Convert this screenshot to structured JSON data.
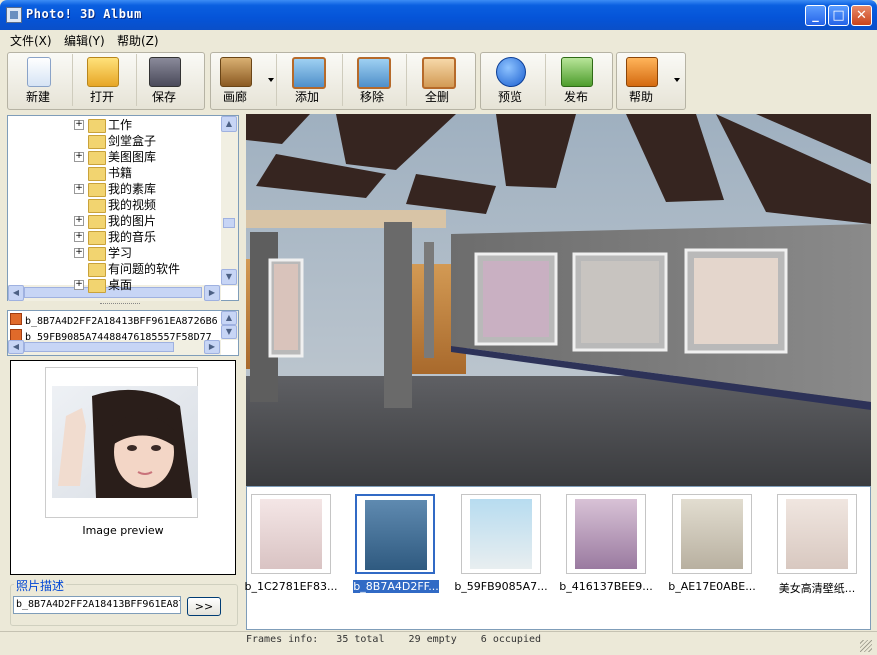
{
  "window": {
    "title": "Photo! 3D Album",
    "controls": {
      "minimize": "_",
      "maximize": "□",
      "close": "✕"
    }
  },
  "menu": [
    "文件(X)",
    "编辑(Y)",
    "帮助(Z)"
  ],
  "toolbar": {
    "new": "新建",
    "open": "打开",
    "save": "保存",
    "gallery": "画廊",
    "add": "添加",
    "remove": "移除",
    "clear_all": "全删",
    "preview": "预览",
    "publish": "发布",
    "help": "帮助"
  },
  "tree": {
    "items": [
      {
        "label": "工作",
        "expandable": true
      },
      {
        "label": "剑堂盒子",
        "expandable": false
      },
      {
        "label": "美图图库",
        "expandable": true
      },
      {
        "label": "书籍",
        "expandable": false
      },
      {
        "label": "我的素库",
        "expandable": true
      },
      {
        "label": "我的视频",
        "expandable": false
      },
      {
        "label": "我的图片",
        "expandable": true
      },
      {
        "label": "我的音乐",
        "expandable": true
      },
      {
        "label": "学习",
        "expandable": true
      },
      {
        "label": "有问题的软件",
        "expandable": false
      },
      {
        "label": "桌面",
        "expandable": true
      }
    ]
  },
  "files": [
    "b_8B7A4D2FF2A18413BFF961EA8726B6",
    "b_59FB9085A74488476185557F58D77"
  ],
  "preview": {
    "caption": "Image preview"
  },
  "description": {
    "legend": "照片描述",
    "value": "b_8B7A4D2FF2A18413BFF961EA87",
    "next_label": ">>"
  },
  "thumbnails": [
    {
      "label": "b_1C2781EF83...",
      "selected": false
    },
    {
      "label": "b_8B7A4D2FF...",
      "selected": true
    },
    {
      "label": "b_59FB9085A7...",
      "selected": false
    },
    {
      "label": "b_416137BEE9...",
      "selected": false
    },
    {
      "label": "b_AE17E0ABE...",
      "selected": false
    },
    {
      "label": "美女高清壁纸...",
      "selected": false
    }
  ],
  "status": {
    "text": "Frames info:   35 total    29 empty    6 occupied"
  },
  "colors": {
    "title_blue": "#0554d8",
    "selection": "#316ac5"
  }
}
